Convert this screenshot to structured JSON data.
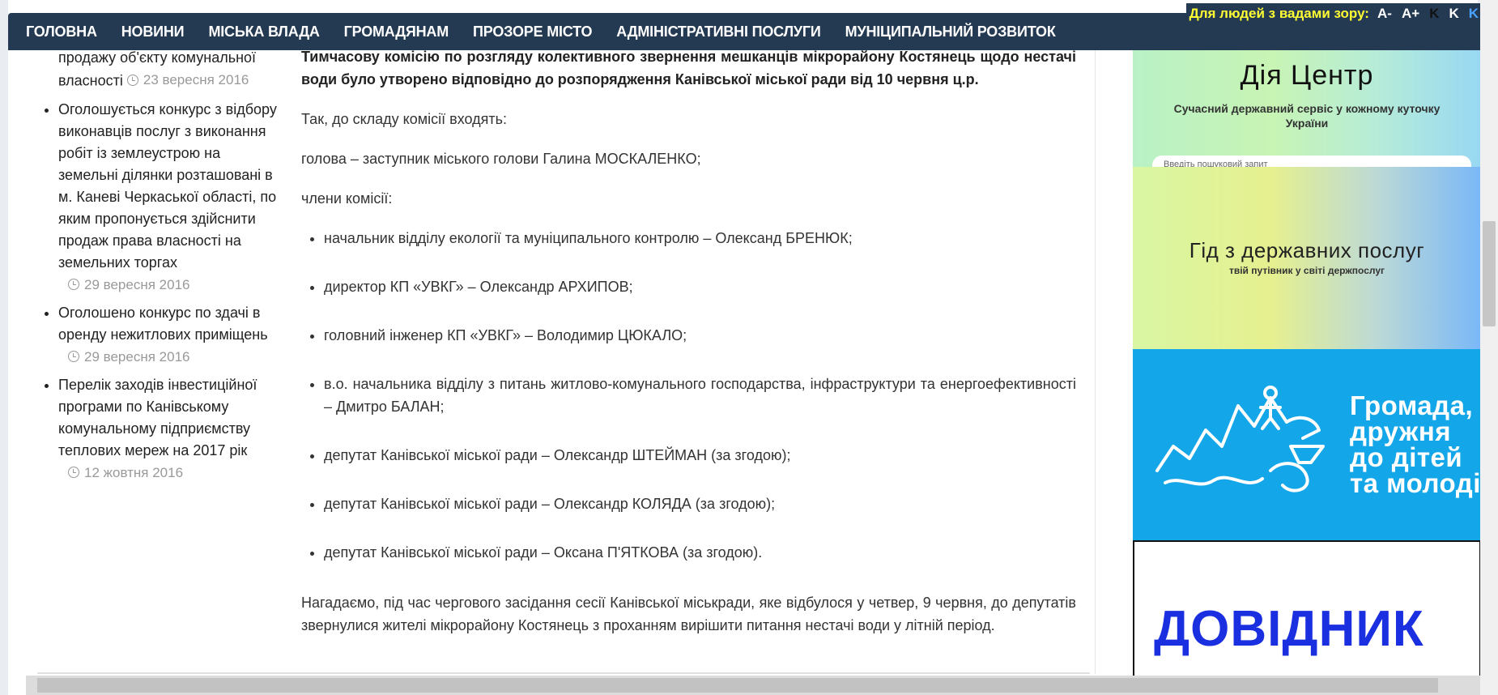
{
  "nav": {
    "items": [
      "ГОЛОВНА",
      "НОВИНИ",
      "МІСЬКА ВЛАДА",
      "ГРОМАДЯНАМ",
      "ПРОЗОРЕ МІСТО",
      "АДМІНІСТРАТИВНІ ПОСЛУГИ",
      "МУНІЦИПАЛЬНИЙ РОЗВИТОК"
    ],
    "accessibility": {
      "label": "Для людей з вадами зору:",
      "decrease": "A-",
      "increase": "A+",
      "k1": "K",
      "k2": "K",
      "k3": "K"
    }
  },
  "sidebar": {
    "items": [
      {
        "title": "продажу об'єкту комунальної власності",
        "date": "23 вересня 2016"
      },
      {
        "title": "Оголошується конкурс з відбору виконавців послуг з виконання робіт із землеустрою на земельні ділянки розташовані в м. Каневі Черкаської області, по яким пропонується здійснити продаж права власності на земельних торгах",
        "date": "29 вересня 2016"
      },
      {
        "title": "Оголошено конкурс по здачі в оренду нежитлових приміщень",
        "date": "29 вересня 2016"
      },
      {
        "title": "Перелік заходів інвестиційної програми по Канівському комунальному підприємству теплових мереж на 2017 рік",
        "date": "12 жовтня 2016"
      }
    ]
  },
  "article": {
    "lead": "Тимчасову комісію по розгляду колективного звернення мешканців мікрорайону Костянець щодо нестачі води було утворено відповідно до розпорядження Канівської міської ради від 10 червня ц.р.",
    "p1": "Так, до складу комісії входять:",
    "p2": "голова – заступник міського голови Галина МОСКАЛЕНКО;",
    "p3": "члени комісії:",
    "members": [
      "начальник відділу екології та муніципального контролю – Олександ БРЕНЮК;",
      "директор КП «УВКГ» – Олександр АРХИПОВ;",
      "головний інженер КП «УВКГ» – Володимир ЦЮКАЛО;",
      "в.о. начальника відділу з питань житлово-комунального господарства, інфраструктури та енергоефективності – Дмитро БАЛАН;",
      "депутат Канівської міської ради – Олександр ШТЕЙМАН (за згодою);",
      "депутат Канівської міської ради – Олександр КОЛЯДА (за згодою);",
      "депутат Канівської міської ради – Оксана П'ЯТКОВА (за згодою)."
    ],
    "p4": "Нагадаємо, під час чергового засідання сесії Канівської міськради, яке відбулося у четвер, 9 червня, до депутатів звернулися жителі мікрорайону Костянець з проханням вирішити питання нестачі води у літній період."
  },
  "banners": {
    "diia": {
      "title": "Дія Центр",
      "subtitle": "Сучасний державний сервіс у кожному куточку України",
      "search_placeholder": "Введіть пошуковий запит"
    },
    "guide": {
      "title": "Гід з державних послуг",
      "subtitle": "твій путівник у світі держпослуг"
    },
    "hromada": {
      "line1": "Громада,",
      "line2": "дружня",
      "line3": "до дітей",
      "line4": "та молоді"
    },
    "dovidnyk": {
      "title": "ДОВІДНИК"
    }
  },
  "colors": {
    "nav_bg": "#243a52",
    "accent_yellow": "#ffff33",
    "hromada_blue": "#13a6e8",
    "dovidnyk_blue": "#1a2fe0"
  }
}
